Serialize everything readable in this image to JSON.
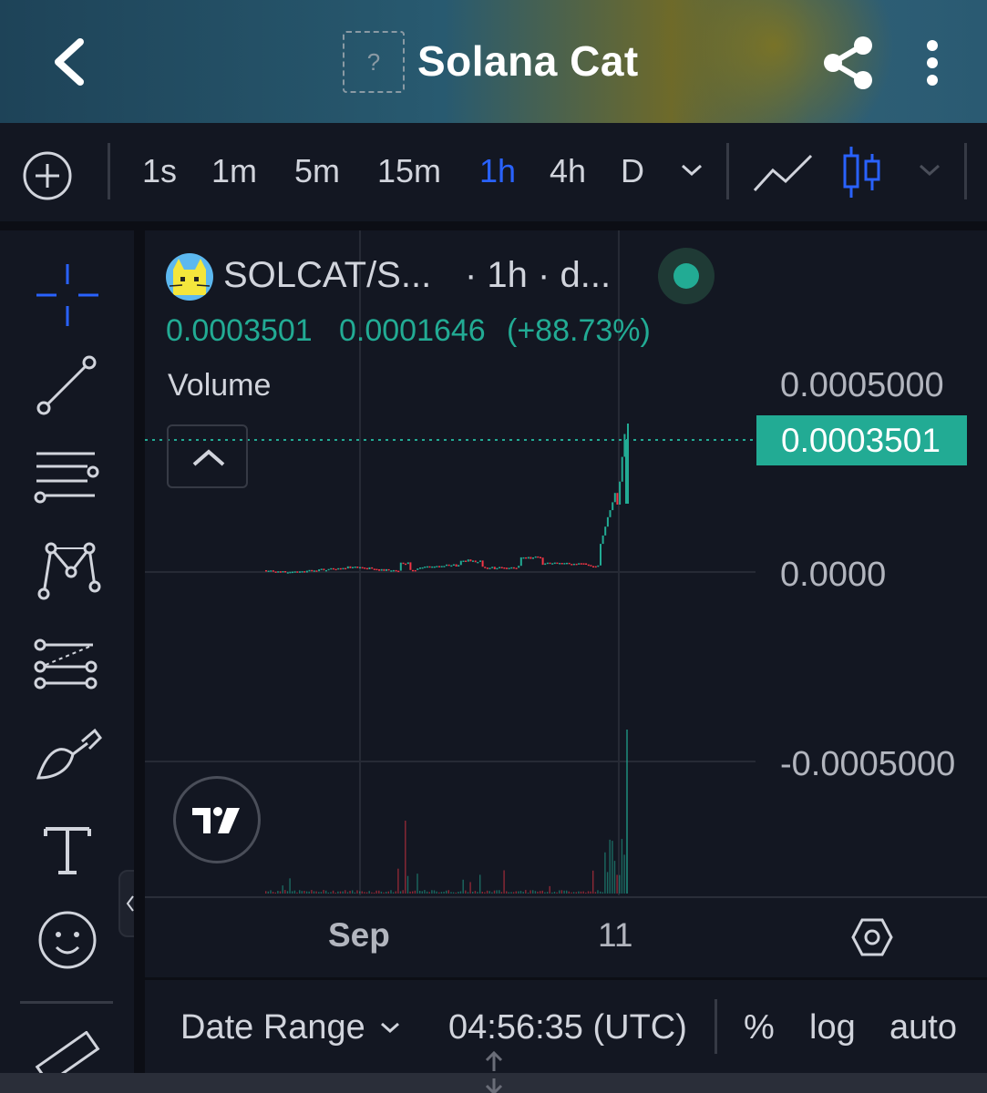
{
  "header": {
    "title": "Solana Cat",
    "placeholder_icon_text": "?"
  },
  "toolbar": {
    "intervals": [
      "1s",
      "1m",
      "5m",
      "15m",
      "1h",
      "4h",
      "D"
    ],
    "active_interval": "1h"
  },
  "legend": {
    "symbol": "SOLCAT/S...",
    "interval_info": "· 1h · d...",
    "last_price": "0.0003501",
    "change": "0.0001646",
    "change_pct": "(+88.73%)",
    "volume_label": "Volume"
  },
  "price_axis": {
    "ticks": [
      "0.0005000",
      "0.0000",
      "-0.0005000"
    ],
    "current_price_badge": "0.0003501"
  },
  "time_axis": {
    "labels": [
      "Sep",
      "11"
    ]
  },
  "bottom_bar": {
    "date_range": "Date Range",
    "clock": "04:56:35 (UTC)",
    "percent": "%",
    "log": "log",
    "auto": "auto"
  },
  "colors": {
    "up": "#22ab94",
    "down": "#f23645",
    "accent": "#2962ff",
    "background": "#131722"
  },
  "icons": [
    "back-arrow-icon",
    "share-icon",
    "more-vertical-icon",
    "add-circle-icon",
    "chevron-down-icon",
    "line-chart-icon",
    "candles-icon",
    "crosshair-icon",
    "trend-line-icon",
    "parallel-lines-icon",
    "pattern-icon",
    "fib-icon",
    "brush-icon",
    "text-icon",
    "emoji-icon",
    "ruler-icon",
    "chevron-up-icon",
    "hexagon-settings-icon",
    "tradingview-logo-icon"
  ]
}
